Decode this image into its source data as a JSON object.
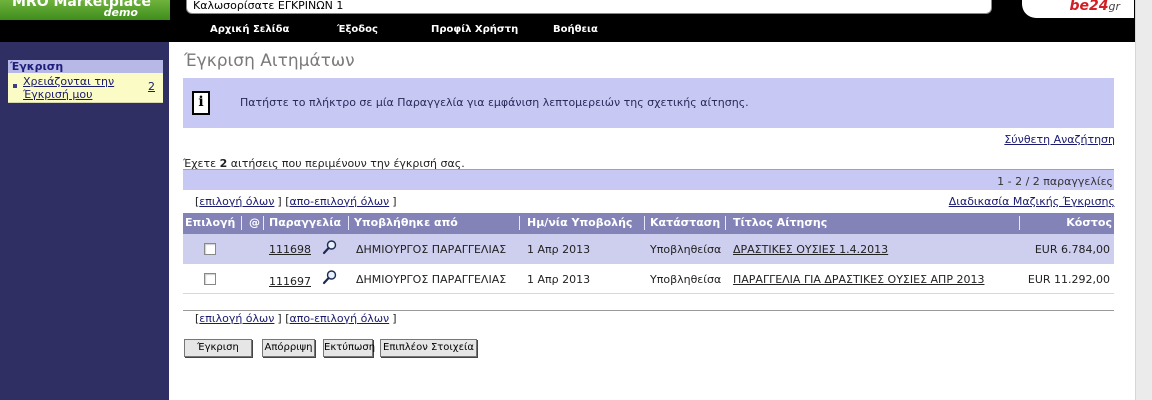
{
  "header": {
    "app_name": "MRO Marketplace",
    "app_tag": "demo",
    "welcome": "Καλωσορίσατε ΕΓΚΡΙΝΩΝ 1",
    "brand_main": "be24",
    "brand_tail": "gr"
  },
  "nav": {
    "items": [
      {
        "label": "Αρχική Σελίδα"
      },
      {
        "label": "Έξοδος"
      },
      {
        "label": "Προφίλ Χρήστη"
      },
      {
        "label": "Βοήθεια"
      }
    ]
  },
  "sidebar": {
    "title": "Έγκριση",
    "item_label": "Χρειάζονται την Έγκρισή μου",
    "item_count": "2"
  },
  "main": {
    "page_title": "Έγκριση Αιτημάτων",
    "info_text": "Πατήστε το πλήκτρο σε μία Παραγγελία για εμφάνιση λεπτομερειών της σχετικής αίτησης.",
    "advanced_search": "Σύνθετη Αναζήτηση",
    "pending_prefix": "Έχετε",
    "pending_count": "2",
    "pending_suffix": "αιτήσεις που περιμένουν την έγκρισή σας.",
    "pager": "1 - 2 / 2 παραγγελίες",
    "select_all": "επιλογή όλων",
    "deselect_all": "απο-επιλογή όλων",
    "bulk_approval": "Διαδικασία Μαζικής Έγκρισης"
  },
  "table": {
    "columns": {
      "select": "Επιλογή",
      "attach": "@",
      "order": "Παραγγελία",
      "submitted_by": "Υποβλήθηκε από",
      "date": "Ημ/νία Υποβολής",
      "status": "Κατάσταση",
      "title": "Τίτλος Αίτησης",
      "cost": "Κόστος"
    },
    "rows": [
      {
        "order": "111698",
        "submitted_by": "ΔΗΜΙΟΥΡΓΟΣ ΠΑΡΑΓΓΕΛΙΑΣ",
        "date": "1 Απρ 2013",
        "status": "Υποβληθείσα",
        "title": "ΔΡΑΣΤΙΚΕΣ ΟΥΣΙΕΣ 1.4.2013",
        "cost": "EUR 6.784,00"
      },
      {
        "order": "111697",
        "submitted_by": "ΔΗΜΙΟΥΡΓΟΣ ΠΑΡΑΓΓΕΛΙΑΣ",
        "date": "1 Απρ 2013",
        "status": "Υποβληθείσα",
        "title": "ΠΑΡΑΓΓΕΛΙΑ ΓΙΑ ΔΡΑΣΤΙΚΕΣ ΟΥΣΙΕΣ ΑΠΡ 2013",
        "cost": "EUR 11.292,00"
      }
    ]
  },
  "actions": {
    "approve": "Έγκριση",
    "reject": "Απόρριψη",
    "print": "Εκτύπωση",
    "more": "Επιπλέον Στοιχεία"
  },
  "colors": {
    "nav_bg": "#000000",
    "sidebar_bg": "#2f2f63",
    "highlight_bg": "#c8c8f4",
    "table_header_bg": "#8383b8",
    "logo_green": "#4a9a25",
    "brand_red": "#d21f26"
  },
  "icons": {
    "info": "info-icon",
    "attachment": "attachment-icon",
    "view": "magnifier-icon"
  }
}
